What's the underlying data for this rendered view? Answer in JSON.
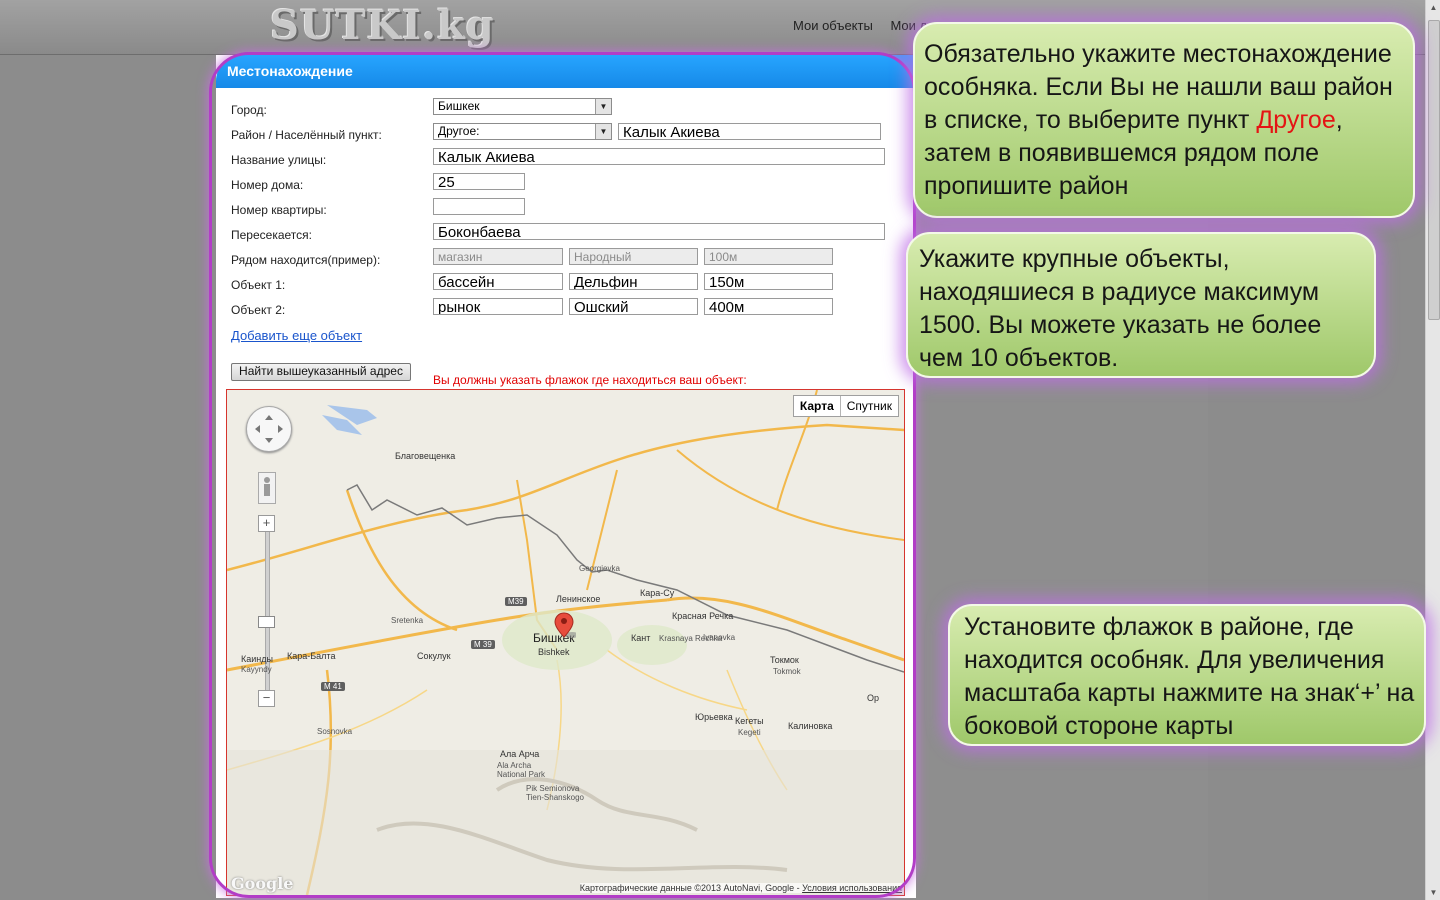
{
  "header": {
    "logo": "SUTKI.kg",
    "nav": [
      "Мои объекты",
      "Мои д"
    ]
  },
  "panel": {
    "title": "Местонахождение",
    "labels": {
      "city": "Город:",
      "district": "Район / Населённый пункт:",
      "street": "Название улицы:",
      "house": "Номер дома:",
      "apartment": "Номер квартиры:",
      "crosses": "Пересекается:",
      "nearby": "Рядом находится(пример):",
      "object1": "Объект 1:",
      "object2": "Объект 2:"
    },
    "city_value": "Бишкек",
    "district_value": "Другое:",
    "district_custom": "Калык Акиева",
    "street_value": "Калык Акиева",
    "house_value": "25",
    "apartment_value": "",
    "crosses_value": "Боконбаева",
    "nearby_example": [
      "магазин",
      "Народный",
      "100м"
    ],
    "object1": [
      "бассейн",
      "Дельфин",
      "150м"
    ],
    "object2": [
      "рынок",
      "Ошский",
      "400м"
    ],
    "add_link": "Добавить еще объект",
    "find_button": "Найти вышеуказанный адрес",
    "warning": "Вы должны указать флажок где находиться ваш объект:"
  },
  "map": {
    "type_buttons": [
      "Карта",
      "Спутник"
    ],
    "places": {
      "blagoveshchenka": "Благовещенка",
      "georgievka": "Georgievka",
      "leninskoe": "Ленинское",
      "karasu": "Кара-Су",
      "bishkek": "Бишкек",
      "bishkek_latin": "Bishkek",
      "sretenka": "Sretenka",
      "sokuluk": "Сокулук",
      "karabalta": "Кара-Балта",
      "kainyy": "Каинды",
      "kayyndy": "Kayyndy",
      "kant": "Кант",
      "krasnaya_rechka": "Красная Речка",
      "krasnaya_rechka_latin": "Krasnaya Rechka",
      "ivanovka": "Ivanovka",
      "tokmok": "Токмок",
      "tokmok_latin": "Tokmok",
      "sosnovka": "Sosnovka",
      "ala_archa": "Ала Арча",
      "ala_archa_latin": "Ala Archa National Park",
      "pik_semionova": "Pik Semionova Tien-Shanskogo",
      "yurevka": "Юрьевка",
      "kegety": "Кегеты",
      "kegeti": "Kegeti",
      "kalinovka": "Калиновка",
      "or": "Ор",
      "m39": "M39",
      "m39b": "M 39",
      "m41": "M 41"
    },
    "copyright": "Картографические данные ©2013 AutoNavi, Google - ",
    "terms": "Условия использования",
    "google_logo": "Google"
  },
  "callouts": {
    "location_part1": "Обязательно укажите местонахождение особняка. Если Вы не нашли ваш район в списке, то выберите пункт ",
    "location_red": "Другое",
    "location_part2": ", затем в появившемся рядом поле пропишите район",
    "objects": "Укажите крупные объекты, находяшиеся в радиусе максимум 1500. Вы можете указать не более чем 10 объектов.",
    "flag": "Установите флажок в районе, где находится особняк. Для увеличения масштаба карты нажмите на знак‘+’ на боковой стороне карты"
  },
  "colors": {
    "header_blue": "#1a93f0",
    "frame_purple": "#b23dc7",
    "callout_green": "#b5d882",
    "warning_red": "#e00000"
  }
}
